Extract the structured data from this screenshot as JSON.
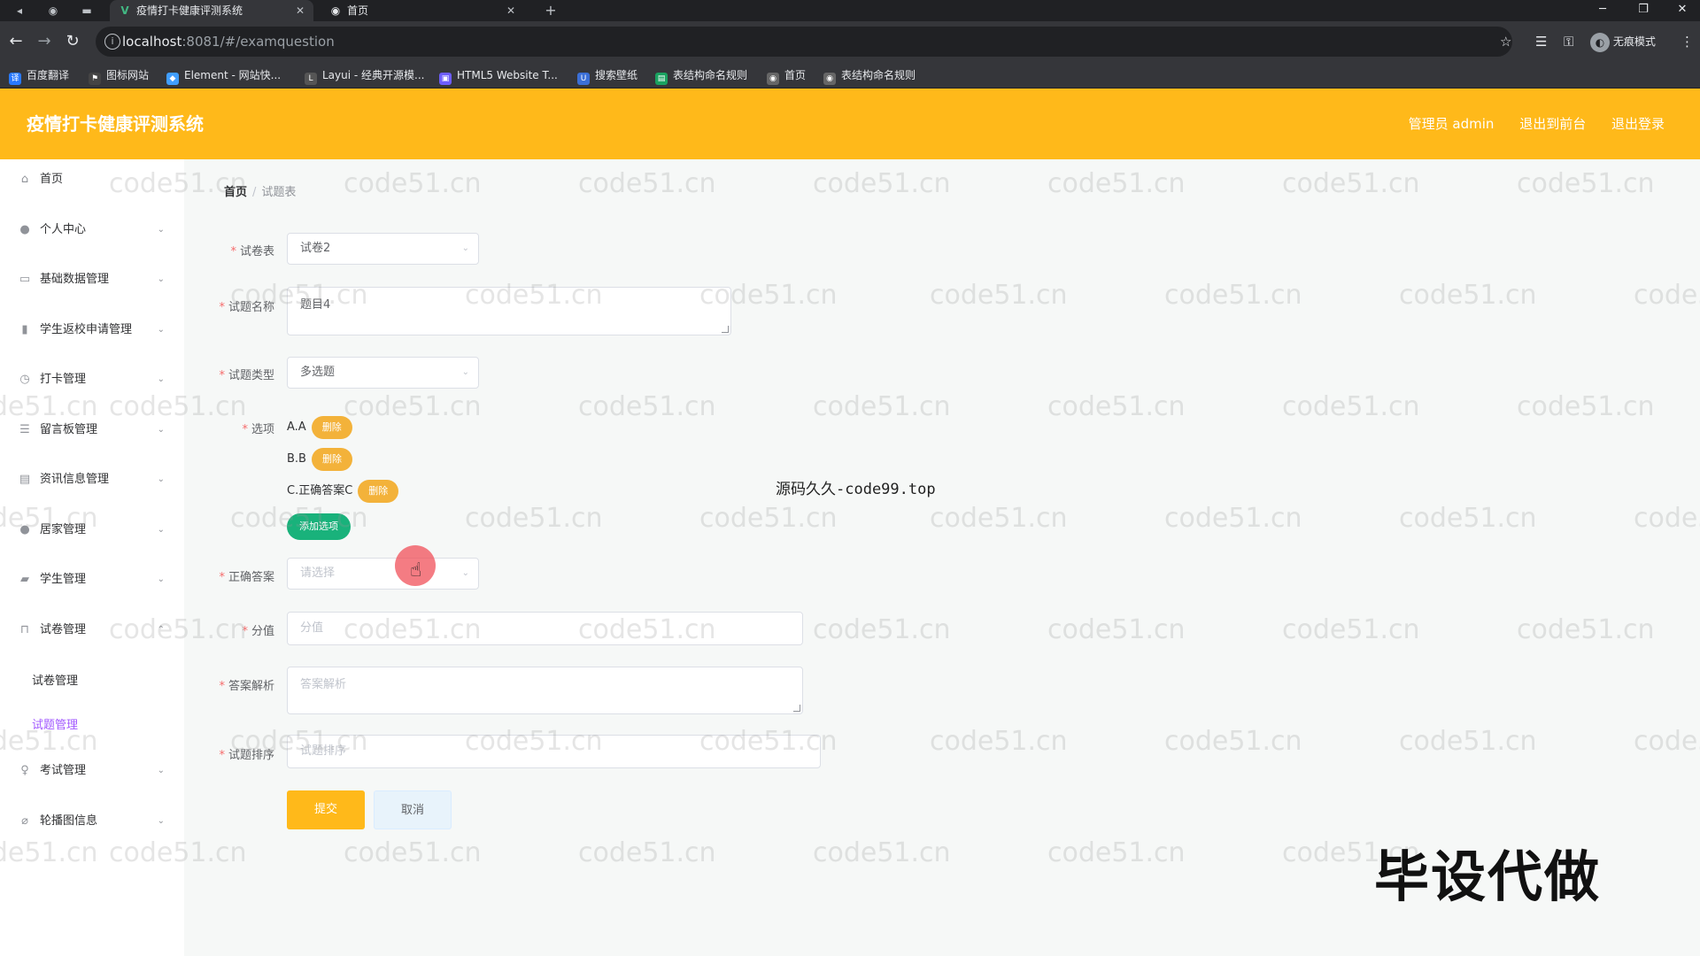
{
  "browser": {
    "tabs": [
      {
        "title": "疫情打卡健康评测系统",
        "active": true
      },
      {
        "title": "首页",
        "active": false
      }
    ],
    "new_tab": "+",
    "url_host": "localhost",
    "url_path": ":8081/#/examquestion",
    "incognito_label": "无痕模式",
    "bookmarks": [
      "百度翻译",
      "图标网站",
      "Element - 网站快...",
      "Layui - 经典开源模...",
      "HTML5 Website T...",
      "搜索壁纸",
      "表结构命名规则",
      "首页",
      "表结构命名规则"
    ]
  },
  "app": {
    "title": "疫情打卡健康评测系统",
    "header_links": [
      "管理员 admin",
      "退出到前台",
      "退出登录"
    ]
  },
  "sidebar": {
    "items": [
      {
        "label": "首页",
        "icon": "home-icon"
      },
      {
        "label": "个人中心",
        "icon": "user-icon"
      },
      {
        "label": "基础数据管理",
        "icon": "data-icon"
      },
      {
        "label": "学生返校申请管理",
        "icon": "chart-icon"
      },
      {
        "label": "打卡管理",
        "icon": "clock-icon"
      },
      {
        "label": "留言板管理",
        "icon": "list-icon"
      },
      {
        "label": "资讯信息管理",
        "icon": "news-icon"
      },
      {
        "label": "居家管理",
        "icon": "house-icon"
      },
      {
        "label": "学生管理",
        "icon": "student-icon"
      },
      {
        "label": "试卷管理",
        "icon": "paper-icon"
      },
      {
        "label": "考试管理",
        "icon": "exam-icon"
      },
      {
        "label": "轮播图信息",
        "icon": "image-icon"
      }
    ],
    "subitems": [
      {
        "label": "试卷管理",
        "active": false
      },
      {
        "label": "试题管理",
        "active": true
      }
    ]
  },
  "breadcrumb": {
    "home": "首页",
    "separator": "/",
    "current": "试题表"
  },
  "form": {
    "paper": {
      "label": "试卷表",
      "value": "试卷2"
    },
    "name": {
      "label": "试题名称",
      "value": "题目4"
    },
    "type": {
      "label": "试题类型",
      "value": "多选题"
    },
    "options": {
      "label": "选项",
      "items": [
        "A.A",
        "B.B",
        "C.正确答案C"
      ],
      "delete_label": "删除",
      "add_label": "添加选项"
    },
    "answer": {
      "label": "正确答案",
      "placeholder": "请选择"
    },
    "score": {
      "label": "分值",
      "placeholder": "分值"
    },
    "analysis": {
      "label": "答案解析",
      "placeholder": "答案解析"
    },
    "sort": {
      "label": "试题排序",
      "placeholder": "试题排序"
    },
    "submit_label": "提交",
    "cancel_label": "取消"
  },
  "watermark": "code51.cn",
  "overlays": {
    "source": "源码久久-code99.top",
    "promo": "毕设代做"
  }
}
